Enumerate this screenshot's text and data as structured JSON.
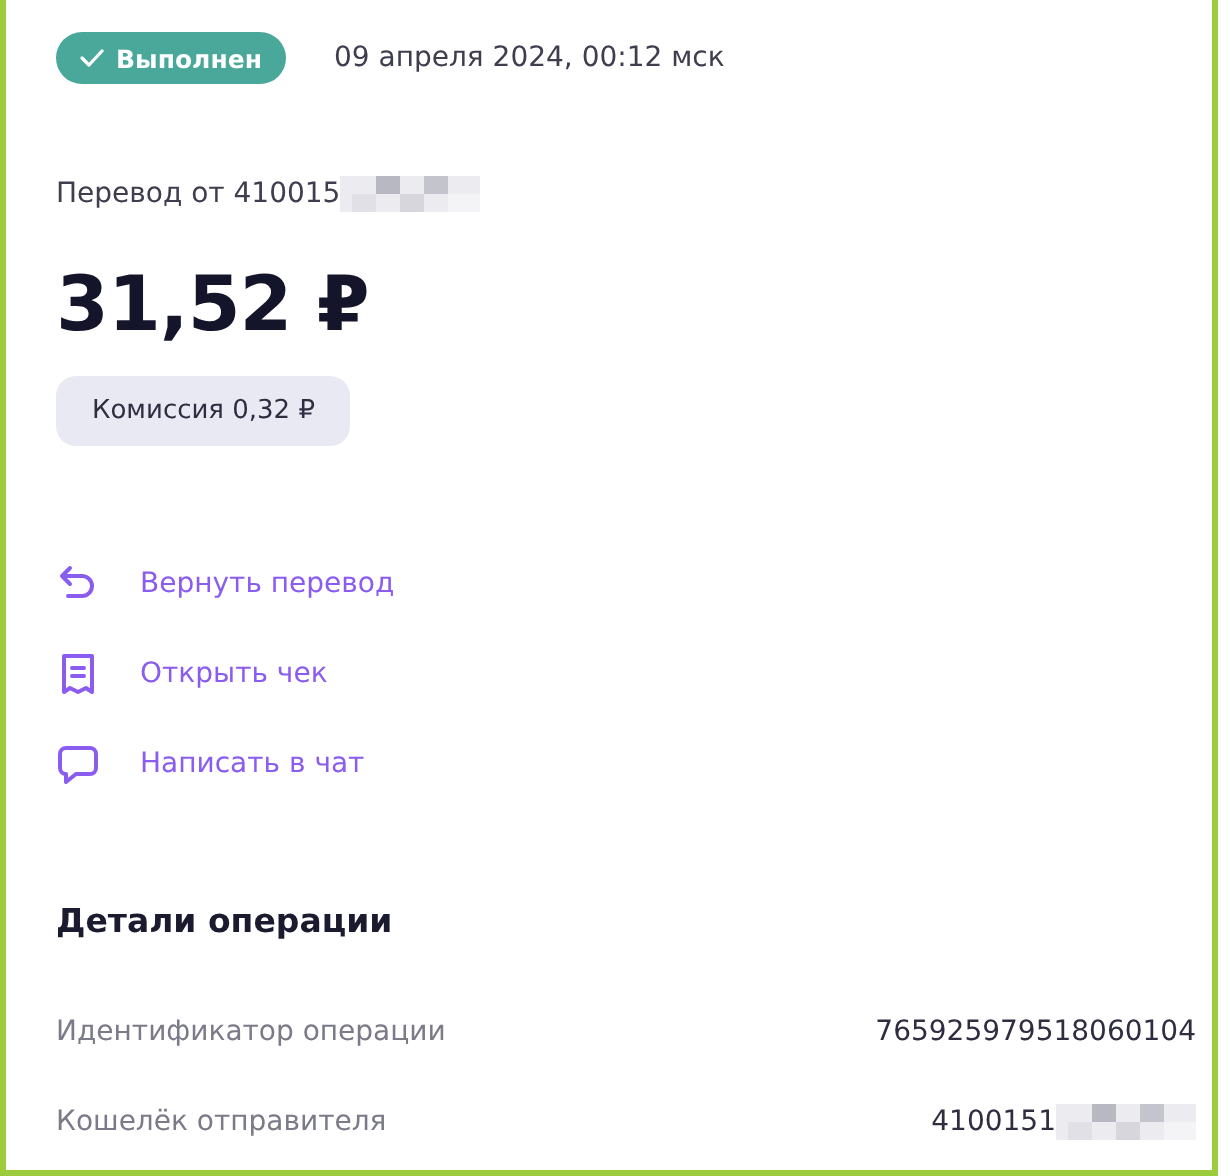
{
  "status": {
    "label": "Выполнен"
  },
  "date": "09 апреля 2024, 00:12 мск",
  "transfer": {
    "label": "Перевод от 410015",
    "redacted": true
  },
  "amount": "31,52 ₽",
  "commission": "Комиссия 0,32 ₽",
  "actions": [
    {
      "kind": "return",
      "label": "Вернуть перевод"
    },
    {
      "kind": "receipt",
      "label": "Открыть чек"
    },
    {
      "kind": "chat",
      "label": "Написать в чат"
    }
  ],
  "details": {
    "title": "Детали операции",
    "rows": [
      {
        "label": "Идентификатор операции",
        "value": "765925979518060104",
        "redacted": false
      },
      {
        "label": "Кошелёк отправителя",
        "value": "4100151",
        "redacted": true
      }
    ]
  }
}
